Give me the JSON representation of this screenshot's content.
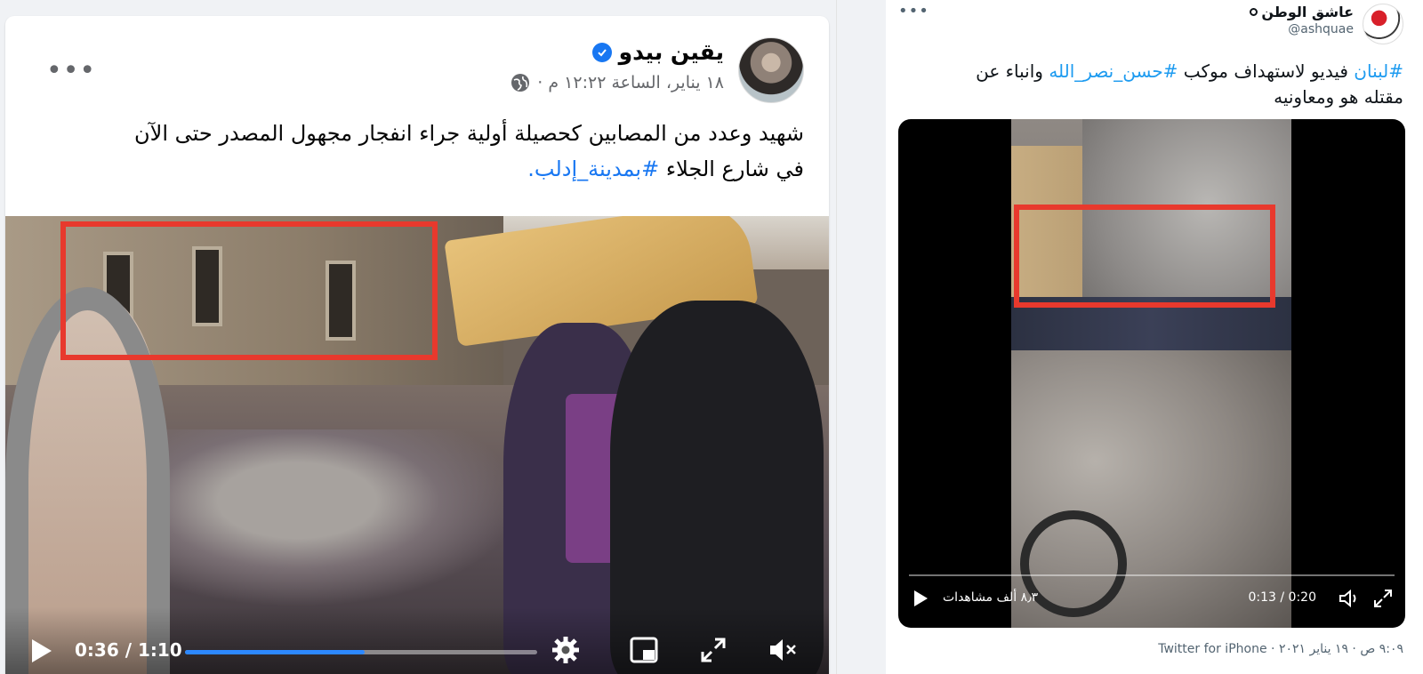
{
  "facebook_post": {
    "author_name": "يقين بيدو",
    "timestamp": "١٨ يناير، الساعة ١٢:٢٢ م ·",
    "more_label": "•••",
    "text_line1": "شهيد وعدد من المصابين كحصيلة أولية جراء انفجار مجهول المصدر حتى الآن",
    "text_line2_prefix": "في شارع الجلاء ",
    "text_line2_hashtag": "#بمدينة_إدلب.",
    "video": {
      "time_display": "0:36 / 1:10",
      "progress_fraction": 0.51,
      "controls": [
        "play-icon",
        "settings-icon",
        "picture-in-picture-icon",
        "fullscreen-icon",
        "muted-volume-icon"
      ]
    },
    "colors": {
      "hashtag": "#1877f2",
      "verified": "#1877f2",
      "progress": "#2d88ff",
      "highlight_box": "#e8392d"
    }
  },
  "twitter_post": {
    "author_name": "عاشق الوطن",
    "handle": "@ashquae",
    "more_label": "•••",
    "text_line1_hashtag1": "#لبنان",
    "text_line1_mid": " فيديو لاستهداف موكب ",
    "text_line1_hashtag2": "#حسن_نصر_الله",
    "text_line1_end": " وانباء عن",
    "text_line2": "مقتله هو ومعاونيه",
    "video": {
      "views": "٨٫٣ ألف مشاهدات",
      "time_display": "0:13 / 0:20",
      "progress_fraction": 0.0,
      "controls": [
        "play-icon",
        "volume-icon",
        "expand-icon"
      ]
    },
    "footer": "٩:٠٩ ص · ١٩ يناير ٢٠٢١ · Twitter for iPhone",
    "colors": {
      "hashtag": "#1d9bf0",
      "highlight_box": "#e8392d"
    }
  }
}
